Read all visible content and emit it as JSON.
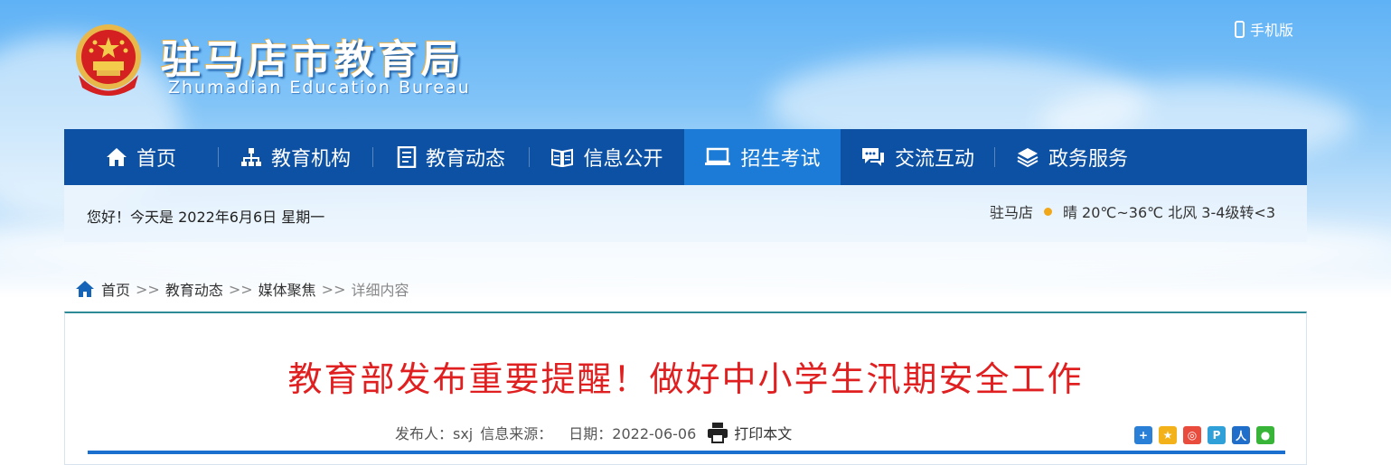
{
  "header": {
    "site_title": "驻马店市教育局",
    "site_subtitle": "Zhumadian Education Bureau",
    "mobile_label": "手机版"
  },
  "nav": {
    "items": [
      {
        "label": "首页",
        "icon": "home-icon"
      },
      {
        "label": "教育机构",
        "icon": "org-chart-icon"
      },
      {
        "label": "教育动态",
        "icon": "document-icon"
      },
      {
        "label": "信息公开",
        "icon": "book-icon"
      },
      {
        "label": "招生考试",
        "icon": "laptop-icon",
        "active": true
      },
      {
        "label": "交流互动",
        "icon": "chat-icon"
      },
      {
        "label": "政务服务",
        "icon": "layers-icon"
      }
    ]
  },
  "info_bar": {
    "greeting": "您好！今天是 2022年6月6日 星期一",
    "city": "驻马店",
    "weather": "晴 20℃~36℃ 北风 3-4级转<3"
  },
  "breadcrumb": {
    "home": "首页",
    "sep": ">>",
    "level1": "教育动态",
    "level2": "媒体聚焦",
    "current": "详细内容"
  },
  "article": {
    "title": "教育部发布重要提醒！做好中小学生汛期安全工作",
    "publisher": "发布人：sxj",
    "source": "信息来源：",
    "date": "日期：2022-06-06",
    "print_label": "打印本文"
  },
  "colors": {
    "nav_bg": "#0c51a4",
    "nav_active": "#1b7bd6",
    "title_red": "#e02020"
  }
}
